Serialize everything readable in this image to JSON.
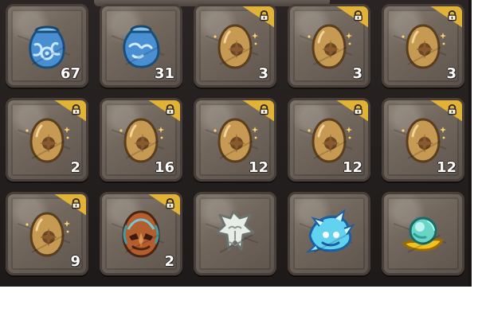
{
  "ui": {
    "colors": {
      "panel": "#221e1d",
      "slot": "#7b7064",
      "lock_badge": "#e0b236",
      "count_text": "#ffffff"
    }
  },
  "inventory": {
    "slots": [
      {
        "item_icon": "blue-jar-icon-front",
        "count": "67",
        "locked": false
      },
      {
        "item_icon": "blue-jar-icon-side",
        "count": "31",
        "locked": false
      },
      {
        "item_icon": "golden-egg-icon",
        "count": "3",
        "locked": true
      },
      {
        "item_icon": "golden-egg-icon",
        "count": "3",
        "locked": true
      },
      {
        "item_icon": "golden-egg-icon",
        "count": "3",
        "locked": true
      },
      {
        "item_icon": "golden-egg-icon",
        "count": "2",
        "locked": true
      },
      {
        "item_icon": "golden-egg-icon",
        "count": "16",
        "locked": true
      },
      {
        "item_icon": "golden-egg-icon",
        "count": "12",
        "locked": true
      },
      {
        "item_icon": "golden-egg-icon",
        "count": "12",
        "locked": true
      },
      {
        "item_icon": "golden-egg-icon",
        "count": "12",
        "locked": true
      },
      {
        "item_icon": "golden-egg-icon",
        "count": "9",
        "locked": true
      },
      {
        "item_icon": "tribal-mask-egg-icon",
        "count": "2",
        "locked": true
      },
      {
        "item_icon": "white-spirit-icon",
        "count": "",
        "locked": false
      },
      {
        "item_icon": "ice-dragon-icon",
        "count": "",
        "locked": false
      },
      {
        "item_icon": "crystal-orb-icon",
        "count": "",
        "locked": false
      }
    ]
  }
}
